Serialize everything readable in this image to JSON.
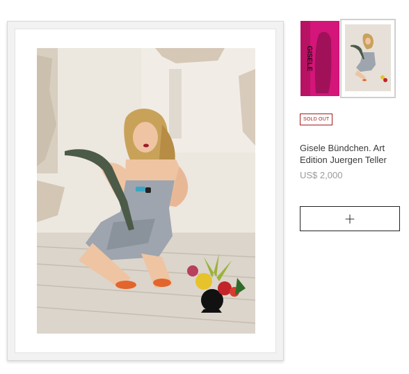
{
  "product": {
    "badge": "SOLD OUT",
    "title": "Gisele Bündchen. Art Edition Juergen Teller",
    "price": "US$ 2,000",
    "add_button_label": "+"
  },
  "book_spine_text": "GISELE",
  "colors": {
    "badge": "#a01a1a",
    "book": "#d4157a",
    "price": "#9a9a9a"
  }
}
